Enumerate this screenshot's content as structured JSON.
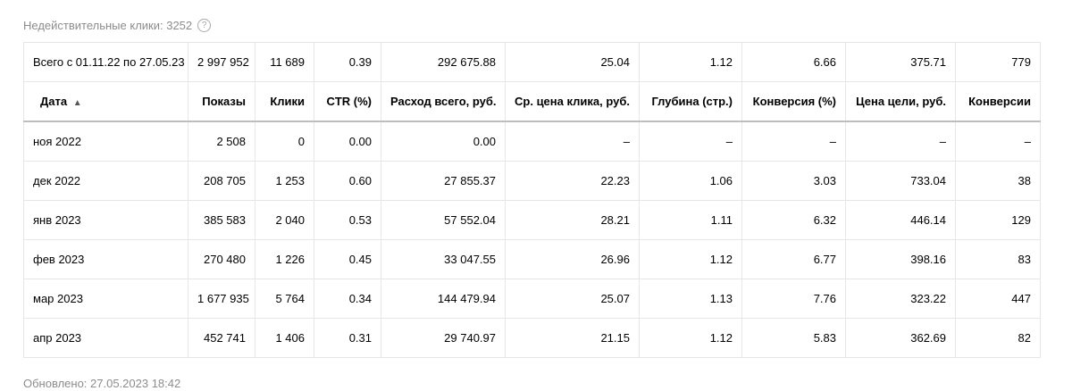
{
  "invalid_clicks": {
    "label": "Недействительные клики: 3252",
    "help_icon": "question-circle-icon"
  },
  "table": {
    "total": [
      "Всего с 01.11.22 по 27.05.23",
      "2 997 952",
      "11 689",
      "0.39",
      "292 675.88",
      "25.04",
      "1.12",
      "6.66",
      "375.71",
      "779"
    ],
    "headers": {
      "date": "Дата",
      "sort_arrow": "▲",
      "impressions": "Показы",
      "clicks": "Клики",
      "ctr": "CTR (%)",
      "spend": "Расход всего, руб.",
      "avg_cpc": "Ср. цена клика, руб.",
      "depth": "Глубина (стр.)",
      "conversion_rate": "Конверсия (%)",
      "goal_cost": "Цена цели, руб.",
      "conversions": "Конверсии"
    },
    "rows": [
      [
        "ноя 2022",
        "2 508",
        "0",
        "0.00",
        "0.00",
        "–",
        "–",
        "–",
        "–",
        "–"
      ],
      [
        "дек 2022",
        "208 705",
        "1 253",
        "0.60",
        "27 855.37",
        "22.23",
        "1.06",
        "3.03",
        "733.04",
        "38"
      ],
      [
        "янв 2023",
        "385 583",
        "2 040",
        "0.53",
        "57 552.04",
        "28.21",
        "1.11",
        "6.32",
        "446.14",
        "129"
      ],
      [
        "фев 2023",
        "270 480",
        "1 226",
        "0.45",
        "33 047.55",
        "26.96",
        "1.12",
        "6.77",
        "398.16",
        "83"
      ],
      [
        "мар 2023",
        "1 677 935",
        "5 764",
        "0.34",
        "144 479.94",
        "25.07",
        "1.13",
        "7.76",
        "323.22",
        "447"
      ],
      [
        "апр 2023",
        "452 741",
        "1 406",
        "0.31",
        "29 740.97",
        "21.15",
        "1.12",
        "5.83",
        "362.69",
        "82"
      ]
    ]
  },
  "footer": {
    "updated": "Обновлено: 27.05.2023 18:42"
  }
}
